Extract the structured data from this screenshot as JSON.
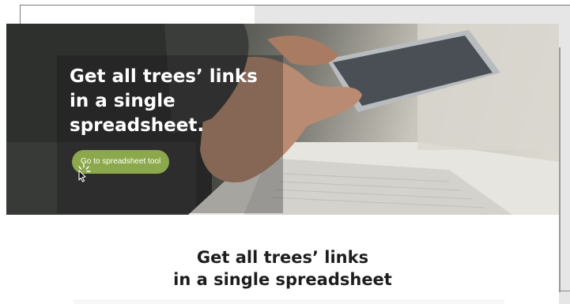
{
  "hero": {
    "title_line1": "Get all trees’ links",
    "title_line2": "in a single",
    "title_line3": "spreadsheet.",
    "cta_label": "Go to spreadsheet tool"
  },
  "section": {
    "title_line1": "Get all trees’ links",
    "title_line2": "in a single spreadsheet"
  },
  "colors": {
    "cta_green": "#8ca84c",
    "heading_dark": "#1d1d1d",
    "hero_text": "#ffffff"
  },
  "icons": {
    "cursor": "pointer-cursor-click-icon"
  }
}
